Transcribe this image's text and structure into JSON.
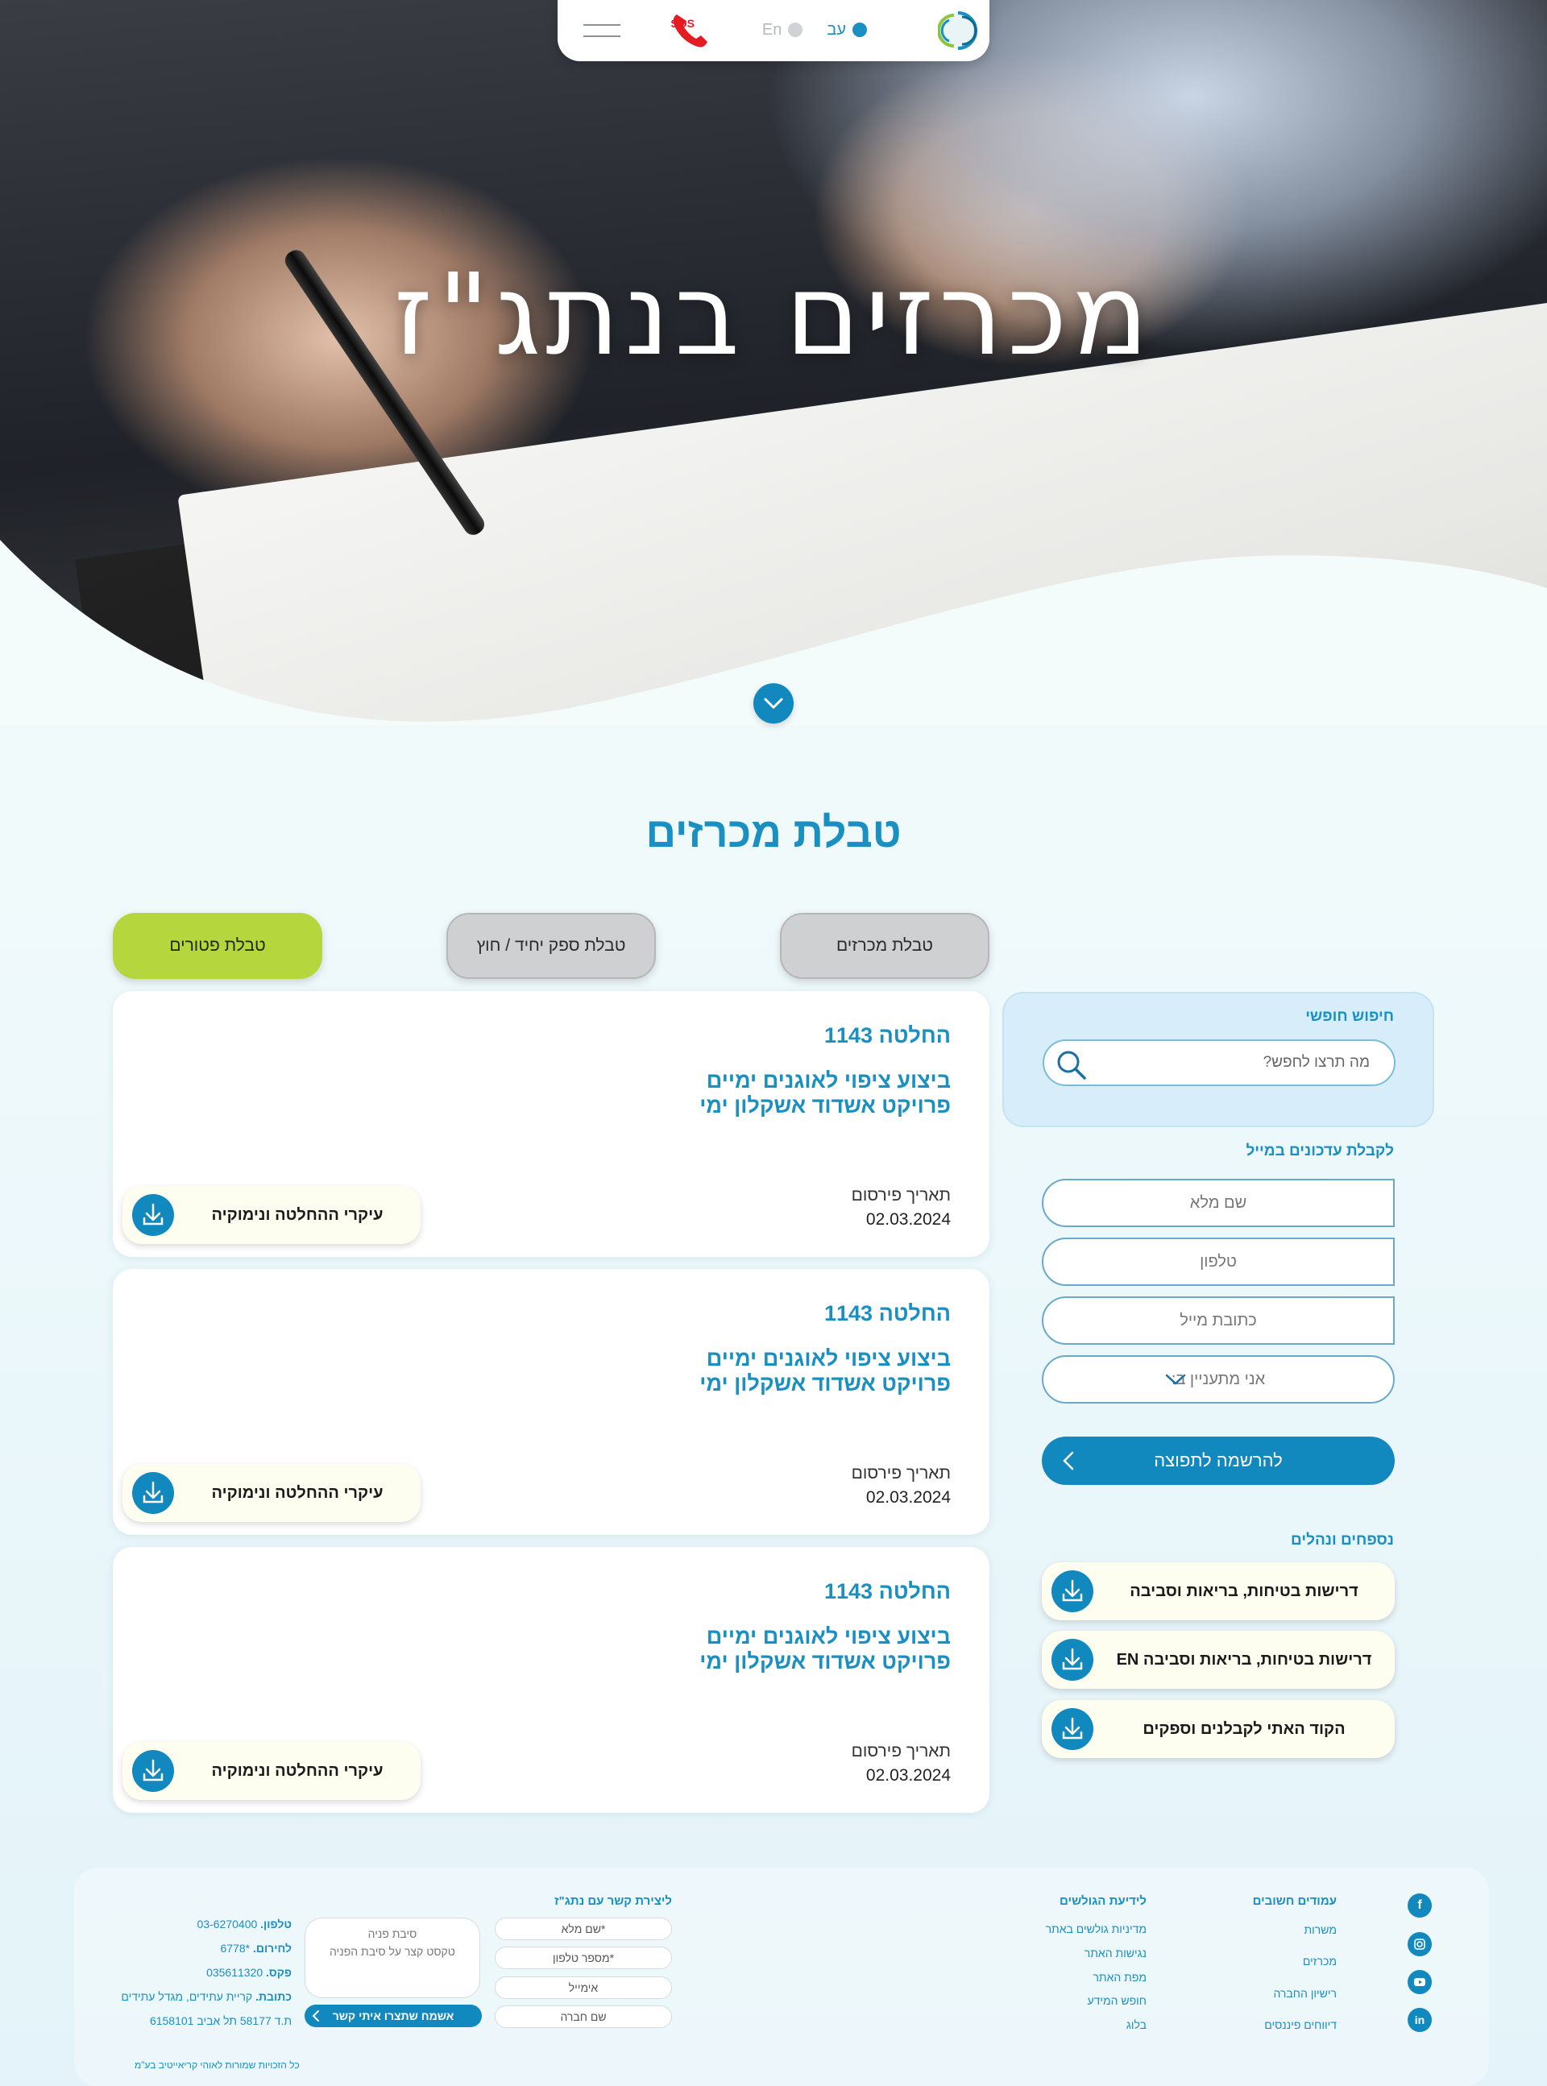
{
  "hero": {
    "title": "מכרזים בנתג\"ז"
  },
  "topbar": {
    "lang_he": "עב",
    "lang_en": "En",
    "sos": "SOS",
    "icons": {
      "logo": "company-logo-icon",
      "sos": "sos-phone-icon",
      "menu": "hamburger-menu-icon"
    }
  },
  "section": {
    "title": "טבלת מכרזים"
  },
  "tabs": [
    {
      "label": "טבלת מכרזים",
      "state": "default"
    },
    {
      "label": "טבלת ספק יחיד / חוץ",
      "state": "default"
    },
    {
      "label": "טבלת פטורים",
      "state": "active"
    }
  ],
  "cards": [
    {
      "number": "החלטה 1143",
      "desc_line1": "ביצוע ציפוי לאוגנים ימיים",
      "desc_line2": "פרויקט אשדוד אשקלון ימי",
      "pub_label": "תאריך פירסום",
      "pub_date": "02.03.2024",
      "download_label": "עיקרי ההחלטה ונימוקיה"
    },
    {
      "number": "החלטה 1143",
      "desc_line1": "ביצוע ציפוי לאוגנים ימיים",
      "desc_line2": "פרויקט אשדוד אשקלון ימי",
      "pub_label": "תאריך פירסום",
      "pub_date": "02.03.2024",
      "download_label": "עיקרי ההחלטה ונימוקיה"
    },
    {
      "number": "החלטה 1143",
      "desc_line1": "ביצוע ציפוי לאוגנים ימיים",
      "desc_line2": "פרויקט אשדוד אשקלון ימי",
      "pub_label": "תאריך פירסום",
      "pub_date": "02.03.2024",
      "download_label": "עיקרי ההחלטה ונימוקיה"
    }
  ],
  "sidebar": {
    "search_title": "חיפוש חופשי",
    "search_placeholder": "מה תרצו לחפש?",
    "updates_title": "לקבלת עדכונים במייל",
    "fields": {
      "name": "שם מלא",
      "phone": "טלפון",
      "email": "כתובת מייל",
      "interest": "אני מתעניין ב:"
    },
    "submit_label": "להרשמה לתפוצה",
    "appendix_title": "נספחים ונהלים",
    "appendix_items": [
      "דרישות בטיחות, בריאות וסביבה",
      "דרישות בטיחות, בריאות וסביבה EN",
      "הקוד האתי לקבלנים וספקים"
    ]
  },
  "footer": {
    "important_pages_title": "עמודים חשובים",
    "important_pages": [
      "משרות",
      "מכרזים",
      "רישיון החברה",
      "דיווחים פיננסים"
    ],
    "surfers_title": "לידיעת הגולשים",
    "surfers_links": [
      "מדיניות גולשים באתר",
      "נגישות האתר",
      "מפת האתר",
      "חופש המידע",
      "בלוג"
    ],
    "contact_title": "ליצירת קשר עם נתג\"ז",
    "contact_fields": [
      "*שם מלא",
      "*מספר טלפון",
      "אימייל",
      "שם חברה"
    ],
    "contact_reason": "סיבת פניה",
    "contact_reason_hint": "טקסט קצר על סיבת הפניה",
    "contact_send": "אשמח שתצרו איתי קשר",
    "phone_label": "טלפון.",
    "phone_value": "03-6270400",
    "emergency_label": "לחירום.",
    "emergency_value": "*6778",
    "fax_label": "פקס.",
    "fax_value": "035611320",
    "address_label": "כתובת.",
    "address_value": "קריית עתידים, מגדל עתידים",
    "pobox": "ת.ד 58177 תל אביב 6158101",
    "copyright": "כל הזכויות שמורות לאוהי קריאייטיב בע\"מ",
    "social": [
      "facebook-icon",
      "instagram-icon",
      "youtube-icon",
      "linkedin-icon"
    ]
  }
}
